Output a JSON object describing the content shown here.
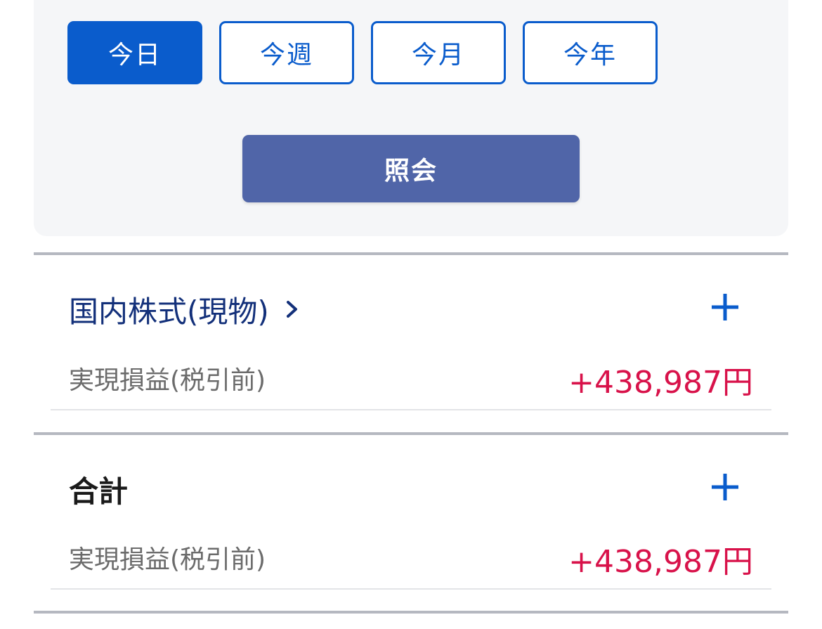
{
  "filter": {
    "periods": [
      {
        "label": "今日",
        "selected": true
      },
      {
        "label": "今週",
        "selected": false
      },
      {
        "label": "今月",
        "selected": false
      },
      {
        "label": "今年",
        "selected": false
      }
    ],
    "query_label": "照会"
  },
  "sections": [
    {
      "title": "国内株式(現物)",
      "has_link": true,
      "expand_icon": "plus-icon",
      "row_label": "実現損益(税引前)",
      "row_value": "+438,987円"
    },
    {
      "title": "合計",
      "has_link": false,
      "expand_icon": "plus-icon",
      "row_label": "実現損益(税引前)",
      "row_value": "+438,987円"
    }
  ],
  "colors": {
    "accent": "#0a5ccc",
    "query_button": "#5065a8",
    "link_title": "#13307a",
    "positive_value": "#d8124a"
  }
}
